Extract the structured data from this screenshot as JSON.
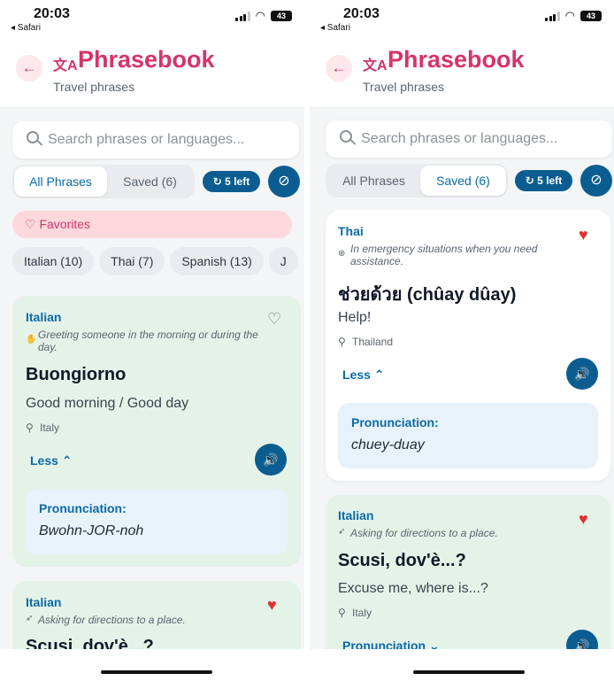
{
  "left_screen": {
    "status": {
      "time": "20:03",
      "back_app": "◂ Safari",
      "battery": "43"
    },
    "header": {
      "back_icon": "←",
      "translate_icon": "文A",
      "title": "Phrasebook",
      "subtitle": "Travel phrases"
    },
    "search": {
      "placeholder": "Search phrases or languages..."
    },
    "tabs": {
      "all": "All Phrases",
      "saved": "Saved (6)",
      "active": "all"
    },
    "left_pill": "↻ 5 left",
    "favorites": "♡ Favorites",
    "chips": [
      "Italian (10)",
      "Thai (7)",
      "Spanish (13)",
      "J"
    ],
    "cards": [
      {
        "language": "Italian",
        "context_icon": "✋",
        "context": "Greeting someone in the morning or during the day.",
        "phrase": "Buongiorno",
        "translation": "Good morning / Good day",
        "country": "Italy",
        "toggle": "Less ⌃",
        "pron_label": "Pronunciation:",
        "pron_value": "Bwohn-JOR-noh",
        "saved": false
      },
      {
        "language": "Italian",
        "context_icon": "➶",
        "context": "Asking for directions to a place.",
        "phrase": "Scusi, dov'è...?",
        "saved": true
      }
    ]
  },
  "right_screen": {
    "status": {
      "time": "20:03",
      "back_app": "◂ Safari",
      "battery": "43"
    },
    "header": {
      "back_icon": "←",
      "translate_icon": "文A",
      "title": "Phrasebook",
      "subtitle": "Travel phrases"
    },
    "search": {
      "placeholder": "Search phrases or languages..."
    },
    "tabs": {
      "all": "All Phrases",
      "saved": "Saved (6)",
      "active": "saved"
    },
    "left_pill": "↻ 5 left",
    "cards": [
      {
        "language": "Thai",
        "context_icon": "⊕",
        "context": "In emergency situations when you need assistance.",
        "phrase": "ช่วยด้วย (chûay dûay)",
        "translation": "Help!",
        "country": "Thailand",
        "toggle": "Less ⌃",
        "pron_label": "Pronunciation:",
        "pron_value": "chuey-duay",
        "saved": true
      },
      {
        "language": "Italian",
        "context_icon": "➶",
        "context": "Asking for directions to a place.",
        "phrase": "Scusi, dov'è...?",
        "translation": "Excuse me, where is...?",
        "country": "Italy",
        "toggle": "Pronunciation ⌄",
        "saved": true
      }
    ]
  },
  "colors": {
    "accent": "#d6336c",
    "primary": "#0b5d91",
    "link": "#0b6aa8",
    "card_green": "#e5f2e8",
    "heart": "#e03131"
  }
}
